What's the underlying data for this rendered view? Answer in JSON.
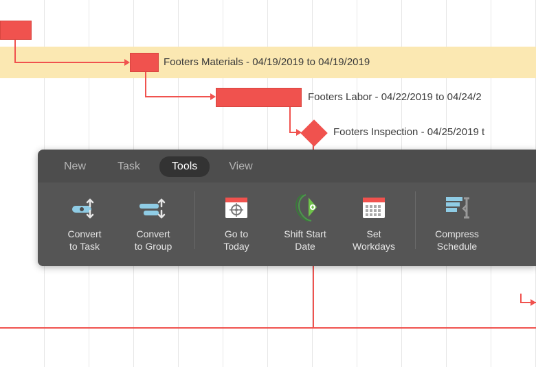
{
  "tasks": {
    "footers_materials": {
      "label": "Footers Materials - 04/19/2019 to 04/19/2019"
    },
    "footers_labor": {
      "label": "Footers Labor - 04/22/2019 to 04/24/2"
    },
    "footers_inspection": {
      "label": "Footers Inspection - 04/25/2019 t"
    }
  },
  "toolbar": {
    "tabs": {
      "new": "New",
      "task": "Task",
      "tools": "Tools",
      "view": "View"
    },
    "tools": {
      "convert_task": "Convert\nto Task",
      "convert_group": "Convert\nto Group",
      "go_today": "Go to\nToday",
      "shift_start": "Shift Start\nDate",
      "set_workdays": "Set\nWorkdays",
      "compress": "Compress\nSchedule"
    }
  },
  "colors": {
    "bar": "#f0524e",
    "highlight": "#fbe8b2",
    "toolbar_bg": "#4d4d4d"
  }
}
